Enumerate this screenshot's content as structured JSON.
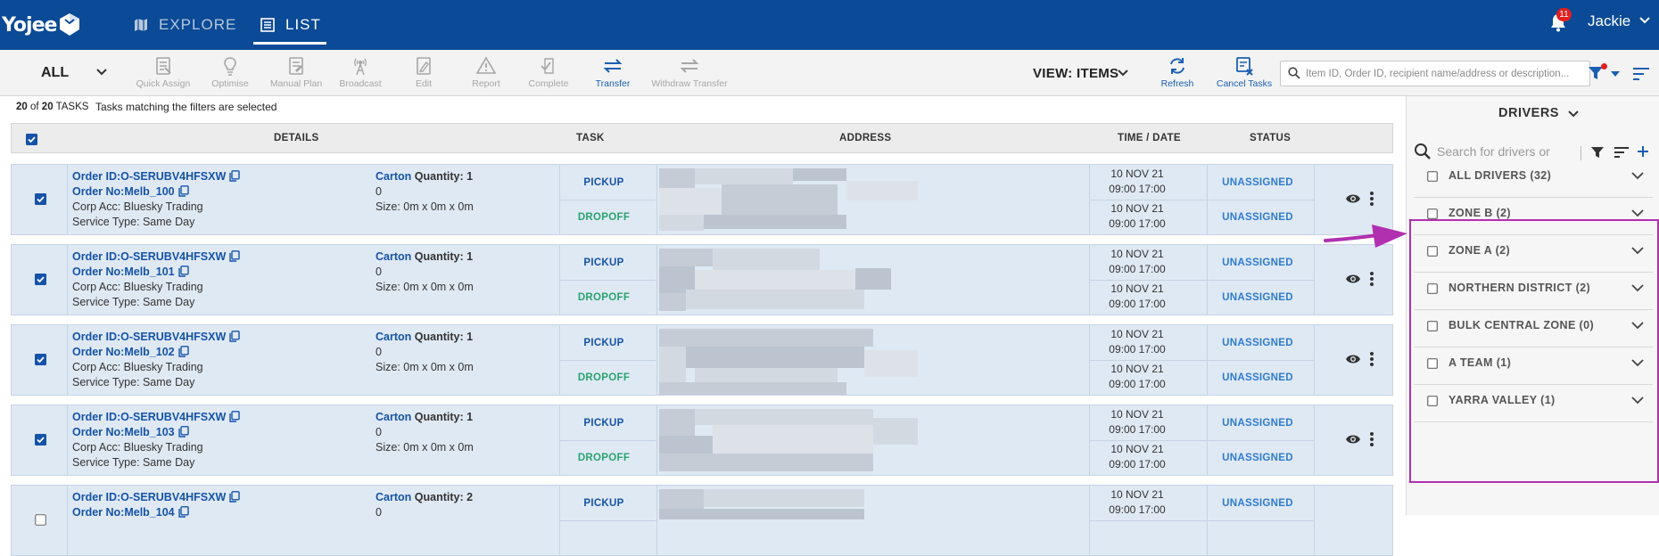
{
  "nav": {
    "logo": "Yojee",
    "explore_label": "EXPLORE",
    "list_label": "LIST",
    "notification_count": "11",
    "user_name": "Jackie"
  },
  "toolbar": {
    "filter_select": "ALL",
    "tools": [
      {
        "label": "Quick Assign",
        "icon": "quick-assign-icon",
        "enabled": false
      },
      {
        "label": "Optimise",
        "icon": "lightbulb-icon",
        "enabled": false
      },
      {
        "label": "Manual Plan",
        "icon": "manual-plan-icon",
        "enabled": false
      },
      {
        "label": "Broadcast",
        "icon": "broadcast-icon",
        "enabled": false
      },
      {
        "label": "Edit",
        "icon": "edit-icon",
        "enabled": false
      },
      {
        "label": "Report",
        "icon": "warning-icon",
        "enabled": false
      },
      {
        "label": "Complete",
        "icon": "complete-icon",
        "enabled": false
      },
      {
        "label": "Transfer",
        "icon": "transfer-icon",
        "enabled": true
      },
      {
        "label": "Withdraw Transfer",
        "icon": "withdraw-transfer-icon",
        "enabled": false
      }
    ],
    "view_label": "VIEW: ITEMS",
    "refresh_label": "Refresh",
    "cancel_tasks_label": "Cancel Tasks",
    "search_placeholder": "Item ID, Order ID, recipient name/address or description..."
  },
  "summary": {
    "count_shown": "20",
    "count_of": "of",
    "count_total": "20",
    "count_unit": "TASKS",
    "message": "Tasks matching the filters are selected"
  },
  "table": {
    "headers": {
      "details": "DETAILS",
      "task": "TASK",
      "address": "ADDRESS",
      "time_date": "TIME / DATE",
      "status": "STATUS"
    },
    "rows": [
      {
        "order_id": "Order ID:O-SERUBV4HFSXW",
        "order_no": "Order No:Melb_100",
        "corp_acc": "Corp Acc: Bluesky Trading",
        "service_type": "Service Type: Same Day",
        "item_type": "Carton",
        "qty_label": "Quantity: 1",
        "qty_sub": "0",
        "size": "Size: 0m x 0m x 0m",
        "task1": "PICKUP",
        "task2": "DROPOFF",
        "date1": "10 NOV 21",
        "time1": "09:00 17:00",
        "date2": "10 NOV 21",
        "time2": "09:00 17:00",
        "status1": "UNASSIGNED",
        "status2": "UNASSIGNED",
        "checked": true
      },
      {
        "order_id": "Order ID:O-SERUBV4HFSXW",
        "order_no": "Order No:Melb_101",
        "corp_acc": "Corp Acc: Bluesky Trading",
        "service_type": "Service Type: Same Day",
        "item_type": "Carton",
        "qty_label": "Quantity: 1",
        "qty_sub": "0",
        "size": "Size: 0m x 0m x 0m",
        "task1": "PICKUP",
        "task2": "DROPOFF",
        "date1": "10 NOV 21",
        "time1": "09:00 17:00",
        "date2": "10 NOV 21",
        "time2": "09:00 17:00",
        "status1": "UNASSIGNED",
        "status2": "UNASSIGNED",
        "checked": true
      },
      {
        "order_id": "Order ID:O-SERUBV4HFSXW",
        "order_no": "Order No:Melb_102",
        "corp_acc": "Corp Acc: Bluesky Trading",
        "service_type": "Service Type: Same Day",
        "item_type": "Carton",
        "qty_label": "Quantity: 1",
        "qty_sub": "0",
        "size": "Size: 0m x 0m x 0m",
        "task1": "PICKUP",
        "task2": "DROPOFF",
        "date1": "10 NOV 21",
        "time1": "09:00 17:00",
        "date2": "10 NOV 21",
        "time2": "09:00 17:00",
        "status1": "UNASSIGNED",
        "status2": "UNASSIGNED",
        "checked": true
      },
      {
        "order_id": "Order ID:O-SERUBV4HFSXW",
        "order_no": "Order No:Melb_103",
        "corp_acc": "Corp Acc: Bluesky Trading",
        "service_type": "Service Type: Same Day",
        "item_type": "Carton",
        "qty_label": "Quantity: 1",
        "qty_sub": "0",
        "size": "Size: 0m x 0m x 0m",
        "task1": "PICKUP",
        "task2": "DROPOFF",
        "date1": "10 NOV 21",
        "time1": "09:00 17:00",
        "date2": "10 NOV 21",
        "time2": "09:00 17:00",
        "status1": "UNASSIGNED",
        "status2": "UNASSIGNED",
        "checked": true
      },
      {
        "order_id": "Order ID:O-SERUBV4HFSXW",
        "order_no": "Order No:Melb_104",
        "corp_acc": "",
        "service_type": "",
        "item_type": "Carton",
        "qty_label": "Quantity: 2",
        "qty_sub": "0",
        "size": "",
        "task1": "PICKUP",
        "task2": "",
        "date1": "10 NOV 21",
        "time1": "09:00 17:00",
        "date2": "",
        "time2": "",
        "status1": "UNASSIGNED",
        "status2": "",
        "checked": false
      }
    ]
  },
  "drivers": {
    "title": "DRIVERS",
    "search_placeholder": "Search for drivers or",
    "groups": [
      {
        "label": "ALL DRIVERS (32)"
      },
      {
        "label": "ZONE B (2)"
      },
      {
        "label": "ZONE A (2)"
      },
      {
        "label": "NORTHERN DISTRICT (2)"
      },
      {
        "label": "BULK CENTRAL ZONE (0)"
      },
      {
        "label": "A TEAM (1)"
      },
      {
        "label": "YARRA VALLEY (1)"
      }
    ]
  },
  "colors": {
    "nav_bg": "#0a4a96",
    "link_blue": "#1553a8",
    "dropoff_green": "#2aa36e",
    "status_blue": "#2e7bd0",
    "highlight_magenta": "#b030b0",
    "row_bg": "#dfe9f4"
  }
}
